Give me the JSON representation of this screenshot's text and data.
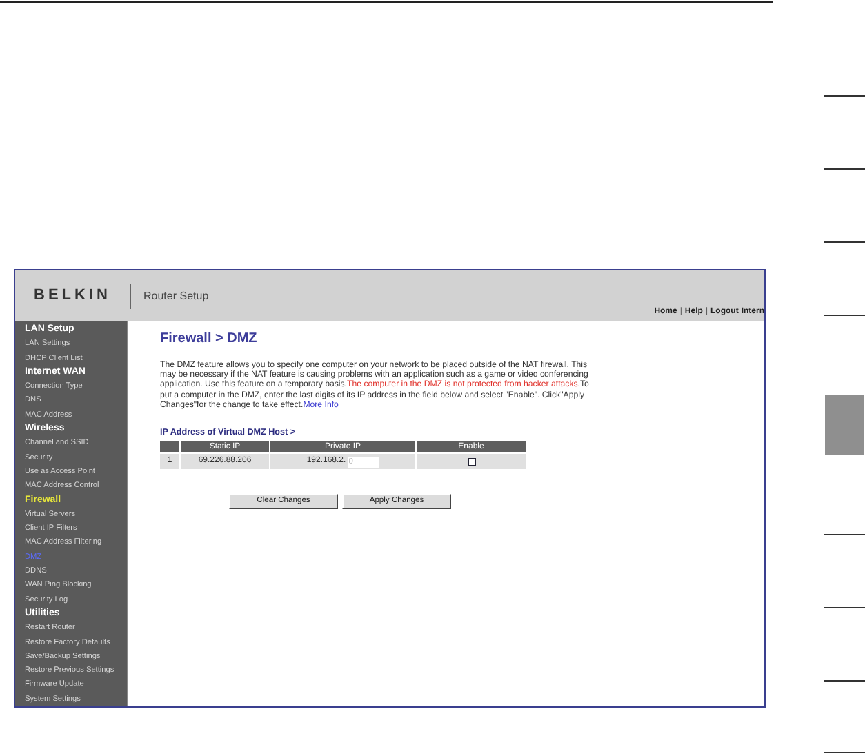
{
  "screenshot": {
    "header": {
      "logo": "BELKIN",
      "title": "Router Setup",
      "nav": [
        {
          "kind": "link",
          "text": "Home"
        },
        {
          "kind": "separator",
          "text": "|"
        },
        {
          "kind": "link",
          "text": "Help"
        },
        {
          "kind": "separator",
          "text": "|"
        },
        {
          "kind": "link",
          "text": "Logout"
        },
        {
          "kind": "link",
          "text": "Intern"
        }
      ]
    },
    "sidebar": [
      {
        "kind": "header",
        "label": "LAN Setup",
        "selected": false
      },
      {
        "kind": "link",
        "label": "LAN Settings",
        "selected": false
      },
      {
        "kind": "link",
        "label": "DHCP Client List",
        "selected": false
      },
      {
        "kind": "header",
        "label": "Internet WAN",
        "selected": false
      },
      {
        "kind": "link",
        "label": "Connection Type",
        "selected": false
      },
      {
        "kind": "link",
        "label": "DNS",
        "selected": false
      },
      {
        "kind": "link",
        "label": "MAC Address",
        "selected": false
      },
      {
        "kind": "header",
        "label": "Wireless",
        "selected": false
      },
      {
        "kind": "link",
        "label": "Channel and SSID",
        "selected": false
      },
      {
        "kind": "link",
        "label": "Security",
        "selected": false
      },
      {
        "kind": "link",
        "label": "Use as Access Point",
        "selected": false
      },
      {
        "kind": "link",
        "label": "MAC Address Control",
        "selected": false
      },
      {
        "kind": "header",
        "label": "Firewall",
        "selected": true
      },
      {
        "kind": "link",
        "label": "Virtual Servers",
        "selected": false
      },
      {
        "kind": "link",
        "label": "Client IP Filters",
        "selected": false
      },
      {
        "kind": "link",
        "label": "MAC Address Filtering",
        "selected": false
      },
      {
        "kind": "link",
        "label": "DMZ",
        "selected": true
      },
      {
        "kind": "link",
        "label": "DDNS",
        "selected": false
      },
      {
        "kind": "link",
        "label": "WAN Ping Blocking",
        "selected": false
      },
      {
        "kind": "link",
        "label": "Security Log",
        "selected": false
      },
      {
        "kind": "header",
        "label": "Utilities",
        "selected": false
      },
      {
        "kind": "link",
        "label": "Restart Router",
        "selected": false
      },
      {
        "kind": "link",
        "label": "Restore Factory Defaults",
        "selected": false
      },
      {
        "kind": "link",
        "label": "Save/Backup Settings",
        "selected": false
      },
      {
        "kind": "link",
        "label": "Restore Previous Settings",
        "selected": false
      },
      {
        "kind": "link",
        "label": "Firmware Update",
        "selected": false
      },
      {
        "kind": "link",
        "label": "System Settings",
        "selected": false
      }
    ],
    "page_title": "Firewall > DMZ",
    "description": [
      {
        "kind": "normal",
        "text": "The DMZ feature allows you to specify one computer on your network to be placed outside of the NAT firewall. This may be necessary if the NAT feature is causing problems with an application such as a game or video conferencing application. Use this feature on a temporary basis."
      },
      {
        "kind": "warning",
        "text": "The computer in the DMZ is not protected from hacker attacks."
      },
      {
        "kind": "normal",
        "text": "To put a computer in the DMZ, enter the last digits of its IP address in the field below and select \"Enable\". Click\"Apply Changes\"for the change to take effect."
      },
      {
        "kind": "link",
        "text": "More Info"
      }
    ],
    "table": {
      "caption": "IP Address of Virtual DMZ Host >",
      "columns": [
        "Static IP",
        "Private IP",
        "Enable"
      ],
      "rows": [
        {
          "index": "1",
          "static_ip": "69.226.88.206",
          "private_ip_prefix": "192.168.2.",
          "placeholder": "0",
          "enabled": false
        }
      ]
    },
    "buttons": [
      "Clear Changes",
      "Apply Changes"
    ]
  }
}
